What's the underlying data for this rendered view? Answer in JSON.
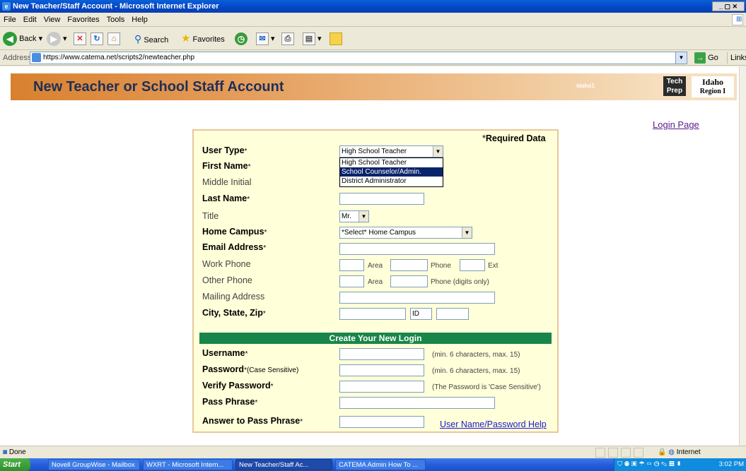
{
  "window": {
    "title": "New Teacher/Staff Account - Microsoft Internet Explorer",
    "controls": "_ ▢ ✕"
  },
  "menu": [
    "File",
    "Edit",
    "View",
    "Favorites",
    "Tools",
    "Help"
  ],
  "toolbar": {
    "back": "Back",
    "search": "Search",
    "favorites": "Favorites"
  },
  "address": {
    "label": "Address",
    "url": "https://www.catema.net/scripts2/newteacher.php",
    "go": "Go",
    "links": "Links"
  },
  "banner": {
    "title": "New Teacher or School Staff Account",
    "code": "idaho1",
    "logo": "Tech Prep",
    "region_line1": "Idaho",
    "region_line2": "Region I"
  },
  "login_link": "Login Page",
  "form": {
    "required_note": "Required Data",
    "required_star": "*",
    "user_type": {
      "label": "User Type",
      "value": "High School Teacher"
    },
    "user_type_options": [
      "High School Teacher",
      "School Counselor/Admin.",
      "District Administrator"
    ],
    "first_name": {
      "label": "First Name"
    },
    "middle_initial": {
      "label": "Middle Initial"
    },
    "last_name": {
      "label": "Last Name"
    },
    "title": {
      "label": "Title",
      "value": "Mr."
    },
    "home_campus": {
      "label": "Home Campus",
      "value": "*Select* Home Campus"
    },
    "email": {
      "label": "Email Address"
    },
    "work_phone": {
      "label": "Work Phone",
      "area": "Area",
      "phone": "Phone",
      "ext": "Ext"
    },
    "other_phone": {
      "label": "Other Phone",
      "area": "Area",
      "phone": "Phone  (digits only)"
    },
    "mailing_address": {
      "label": "Mailing Address"
    },
    "city_state_zip": {
      "label": "City, State, Zip",
      "state_value": "ID"
    },
    "login_section": "Create Your New Login",
    "username": {
      "label": "Username",
      "hint": "(min. 6 characters, max. 15)"
    },
    "password": {
      "label": "Password",
      "sub": "(Case Sensitive)",
      "hint": "(min. 6 characters, max. 15)"
    },
    "verify_password": {
      "label": "Verify Password",
      "hint": "(The Password is 'Case Sensitive')"
    },
    "pass_phrase": {
      "label": "Pass Phrase"
    },
    "answer_pass_phrase": {
      "label": "Answer to Pass Phrase"
    },
    "help_link": "User Name/Password Help"
  },
  "status": {
    "text": "Done",
    "zone": "Internet"
  },
  "taskbar": {
    "start": "Start",
    "tasks": [
      "Novell GroupWise - Mailbox",
      "WXRT - Microsoft Intern...",
      "New Teacher/Staff Ac...",
      "CATEMA Admin How To ..."
    ],
    "clock": "3:02 PM"
  }
}
